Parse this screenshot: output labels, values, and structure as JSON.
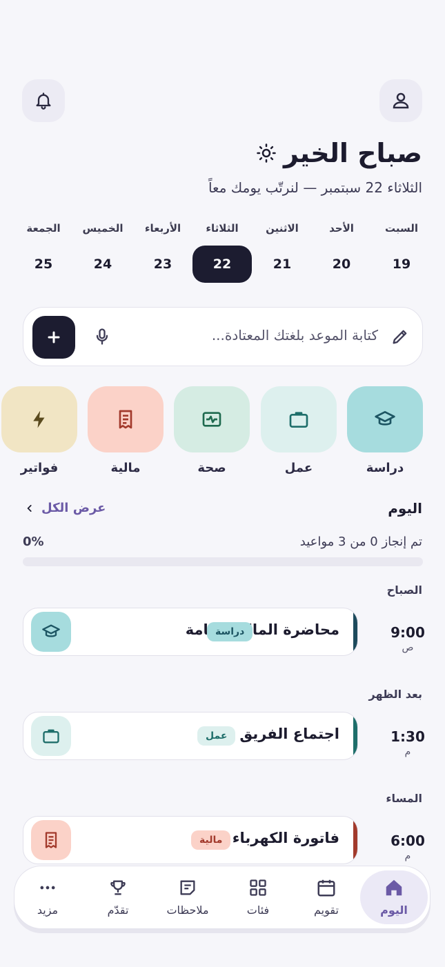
{
  "header": {
    "greeting": "صباح الخير",
    "subtitle": "الثلاثاء 22 سبتمبر — لنرتّب يومك معاً"
  },
  "week": [
    {
      "name": "السبت",
      "num": "19"
    },
    {
      "name": "الأحد",
      "num": "20"
    },
    {
      "name": "الاثنين",
      "num": "21"
    },
    {
      "name": "الثلاثاء",
      "num": "22"
    },
    {
      "name": "الأربعاء",
      "num": "23"
    },
    {
      "name": "الخميس",
      "num": "24"
    },
    {
      "name": "الجمعة",
      "num": "25"
    }
  ],
  "week_selected": "22",
  "input": {
    "placeholder": "كتابة الموعد بلغتك المعتادة..."
  },
  "categories": [
    {
      "label": "دراسة",
      "icon": "graduation-cap-icon",
      "color": "#a6dcde"
    },
    {
      "label": "عمل",
      "icon": "briefcase-icon",
      "color": "#ddf0ee"
    },
    {
      "label": "صحة",
      "icon": "heartbeat-icon",
      "color": "#d5ece3"
    },
    {
      "label": "مالية",
      "icon": "receipt-icon",
      "color": "#fbd2c8"
    },
    {
      "label": "فواتير",
      "icon": "lightning-icon",
      "color": "#f1e5c4"
    }
  ],
  "today": {
    "title": "اليوم",
    "view_all": "عرض الكل",
    "progress_text": "تم إنجاز 0 من 3 مواعيد",
    "progress_pct": "0%",
    "progress_value": 0
  },
  "periods": {
    "morning": "الصباح",
    "afternoon": "بعد الظهر",
    "evening": "المساء"
  },
  "appointments": [
    {
      "time": "9:00",
      "ampm": "ص",
      "title": "محاضرة المالية العامة",
      "badge": "دراسة",
      "icon": "graduation-cap-icon",
      "accent": "#1d4a5c",
      "badge_bg": "#a6dcde",
      "badge_fg": "#1d5563"
    },
    {
      "time": "1:30",
      "ampm": "م",
      "title": "اجتماع الفريق",
      "badge": "عمل",
      "icon": "briefcase-icon",
      "accent": "#1e6e6a",
      "badge_bg": "#ddf0ee",
      "badge_fg": "#1e6e6a"
    },
    {
      "time": "6:00",
      "ampm": "م",
      "title": "فاتورة الكهرباء",
      "badge": "مالية",
      "icon": "receipt-icon",
      "accent": "#a23a2c",
      "badge_bg": "#fbd2c8",
      "badge_fg": "#a23a2c"
    }
  ],
  "nav": [
    {
      "label": "اليوم",
      "icon": "home-icon",
      "active": true
    },
    {
      "label": "تقويم",
      "icon": "calendar-icon"
    },
    {
      "label": "فئات",
      "icon": "grid-icon"
    },
    {
      "label": "ملاحظات",
      "icon": "notes-icon"
    },
    {
      "label": "تقدّم",
      "icon": "trophy-icon"
    },
    {
      "label": "مزيد",
      "icon": "more-icon"
    }
  ]
}
